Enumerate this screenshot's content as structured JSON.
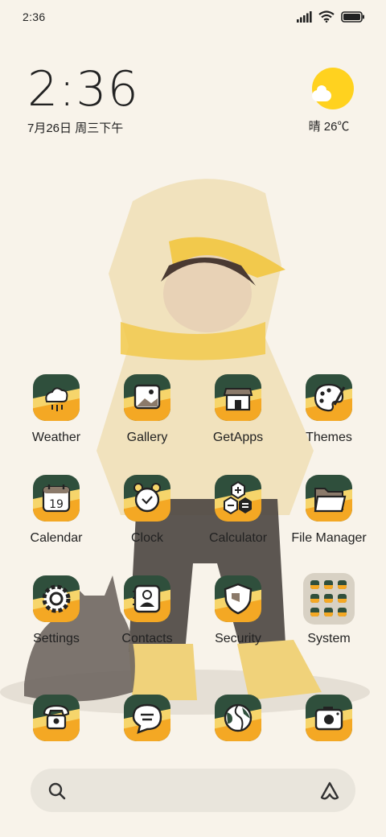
{
  "status_bar": {
    "time": "2:36",
    "icons": [
      "signal-icon",
      "wifi-icon",
      "battery-icon"
    ]
  },
  "clock_widget": {
    "time": "2:36",
    "date": "7月26日 周三下午"
  },
  "weather_widget": {
    "text": "晴 26℃",
    "icon": "sunny-cloud-icon"
  },
  "apps": [
    {
      "label": "Weather",
      "icon": "weather-icon"
    },
    {
      "label": "Gallery",
      "icon": "gallery-icon"
    },
    {
      "label": "GetApps",
      "icon": "store-icon"
    },
    {
      "label": "Themes",
      "icon": "palette-icon"
    },
    {
      "label": "Calendar",
      "icon": "calendar-icon",
      "day": "19"
    },
    {
      "label": "Clock",
      "icon": "alarm-clock-icon"
    },
    {
      "label": "Calculator",
      "icon": "calculator-icon"
    },
    {
      "label": "File Manager",
      "icon": "folder-icon"
    },
    {
      "label": "Settings",
      "icon": "gear-icon"
    },
    {
      "label": "Contacts",
      "icon": "contacts-icon"
    },
    {
      "label": "Security",
      "icon": "shield-icon"
    },
    {
      "label": "System",
      "icon": "folder-grid-icon"
    }
  ],
  "dock": [
    {
      "icon": "phone-icon"
    },
    {
      "icon": "message-icon"
    },
    {
      "icon": "browser-icon"
    },
    {
      "icon": "camera-icon"
    }
  ],
  "search_bar": {
    "left_icon": "search-icon",
    "right_icon": "assistant-icon"
  },
  "colors": {
    "background": "#f8f3ea",
    "icon_dark": "#2f4f3c",
    "icon_orange": "#f4a824",
    "sun": "#ffd21f"
  }
}
